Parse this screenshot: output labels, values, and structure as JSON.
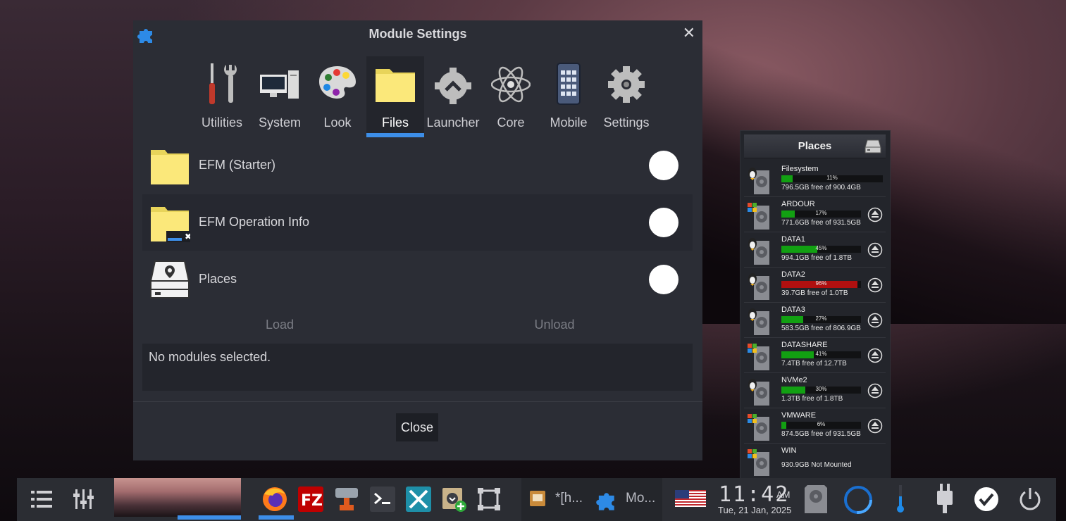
{
  "window": {
    "title": "Module Settings",
    "close_glyph": "✕",
    "icon": "puzzle-icon",
    "tabs": [
      {
        "label": "Utilities",
        "icon": "tools-icon",
        "active": false
      },
      {
        "label": "System",
        "icon": "computer-icon",
        "active": false
      },
      {
        "label": "Look",
        "icon": "palette-icon",
        "active": false
      },
      {
        "label": "Files",
        "icon": "folder-icon",
        "active": true
      },
      {
        "label": "Launcher",
        "icon": "gear-icon",
        "active": false
      },
      {
        "label": "Core",
        "icon": "atom-icon",
        "active": false
      },
      {
        "label": "Mobile",
        "icon": "mobile-icon",
        "active": false
      },
      {
        "label": "Settings",
        "icon": "settings-icon",
        "active": false
      }
    ],
    "modules": [
      {
        "name": "EFM (Starter)",
        "icon": "folder-icon",
        "enabled": false
      },
      {
        "name": "EFM Operation Info",
        "icon": "folder-progress-icon",
        "enabled": false
      },
      {
        "name": "Places",
        "icon": "drive-icon",
        "enabled": false
      }
    ],
    "load_label": "Load",
    "unload_label": "Unload",
    "info_text": "No modules selected.",
    "close_label": "Close"
  },
  "places": {
    "title": "Places",
    "drives": [
      {
        "name": "Filesystem",
        "os": "linux",
        "percent": 11,
        "percent_label": "11%",
        "info": "796.5GB free of 900.4GB",
        "ejectable": false,
        "color": "#12a012"
      },
      {
        "name": "ARDOUR",
        "os": "windows",
        "percent": 17,
        "percent_label": "17%",
        "info": "771.6GB free of 931.5GB",
        "ejectable": true,
        "color": "#12a012"
      },
      {
        "name": "DATA1",
        "os": "linux",
        "percent": 45,
        "percent_label": "45%",
        "info": "994.1GB free of 1.8TB",
        "ejectable": true,
        "color": "#12a012"
      },
      {
        "name": "DATA2",
        "os": "linux",
        "percent": 96,
        "percent_label": "96%",
        "info": "39.7GB free of 1.0TB",
        "ejectable": true,
        "color": "#b01010"
      },
      {
        "name": "DATA3",
        "os": "linux",
        "percent": 27,
        "percent_label": "27%",
        "info": "583.5GB free of 806.9GB",
        "ejectable": true,
        "color": "#12a012"
      },
      {
        "name": "DATASHARE",
        "os": "windows",
        "percent": 41,
        "percent_label": "41%",
        "info": "7.4TB free of 12.7TB",
        "ejectable": true,
        "color": "#12a012"
      },
      {
        "name": "NVMe2",
        "os": "linux",
        "percent": 30,
        "percent_label": "30%",
        "info": "1.3TB free of 1.8TB",
        "ejectable": true,
        "color": "#12a012"
      },
      {
        "name": "VMWARE",
        "os": "windows",
        "percent": 6,
        "percent_label": "6%",
        "info": "874.5GB free of 931.5GB",
        "ejectable": true,
        "color": "#12a012"
      },
      {
        "name": "WIN",
        "os": "windows",
        "percent": null,
        "percent_label": "",
        "info": "930.9GB Not Mounted",
        "ejectable": false,
        "color": "#12a012"
      }
    ]
  },
  "taskbar": {
    "tasks": [
      {
        "label": "*[h...",
        "icon": "image-editor-icon"
      },
      {
        "label": "Mo...",
        "icon": "puzzle-icon"
      }
    ],
    "clock": {
      "time": "11:42",
      "ampm": "AM",
      "date": "Tue, 21 Jan, 2025"
    },
    "accent": "#3d8ee8"
  }
}
